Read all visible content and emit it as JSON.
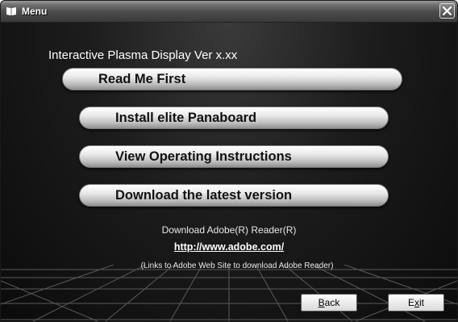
{
  "window": {
    "title": "Menu"
  },
  "main": {
    "heading": "Interactive Plasma Display Ver x.xx",
    "buttons": [
      {
        "label": "Read Me First"
      },
      {
        "label": "Install elite Panaboard"
      },
      {
        "label": "View Operating Instructions"
      },
      {
        "label": "Download the latest version"
      }
    ],
    "adobe": {
      "label": "Download Adobe(R) Reader(R)",
      "link": "http://www.adobe.com/",
      "note": "(Links to Adobe Web Site to download Adobe Reader)"
    }
  },
  "footer": {
    "back_label": "ack",
    "back_mnemonic": "B",
    "exit_label": "it",
    "exit_prefix": "E",
    "exit_mnemonic": "x"
  },
  "icons": {
    "app": "book-icon",
    "close": "close-icon"
  }
}
